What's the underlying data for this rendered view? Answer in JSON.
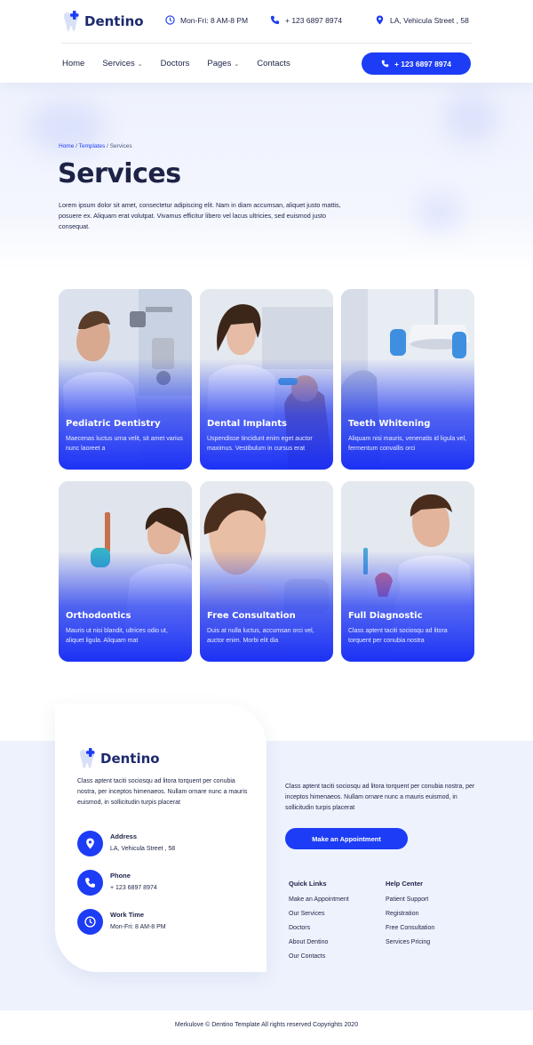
{
  "brand": {
    "name": "Dentino",
    "accent": "#1d3cf5"
  },
  "header": {
    "hours": "Mon-Fri: 8 AM-8 PM",
    "phone": "+ 123 6897 8974",
    "address": "LA, Vehicula Street , 58",
    "nav": [
      {
        "label": "Home",
        "dropdown": false
      },
      {
        "label": "Services",
        "dropdown": true
      },
      {
        "label": "Doctors",
        "dropdown": false
      },
      {
        "label": "Pages",
        "dropdown": true
      },
      {
        "label": "Contacts",
        "dropdown": false
      }
    ],
    "call_button": "+ 123 6897 8974"
  },
  "hero": {
    "breadcrumb": {
      "home": "Home",
      "sep1": " / ",
      "templates": "Templates",
      "sep2": " / ",
      "current": "Services"
    },
    "title": "Services",
    "description": "Lorem ipsum dolor sit amet, consectetur adipiscing elit. Nam in diam accumsan, aliquet justo mattis, posuere ex. Aliquam erat volutpat. Vivamus efficitur libero vel lacus ultricies, sed euismod justo consequat."
  },
  "services": [
    {
      "title": "Pediatric Dentistry",
      "desc": "Maecenas luctus urna velit, sit amet varius nunc laoreet a"
    },
    {
      "title": "Dental Implants",
      "desc": "Uspendisse tincidunt enim eget auctor maximus. Vestibulum in cursus erat"
    },
    {
      "title": "Teeth Whitening",
      "desc": "Aliquam nisi mauris, venenatis id ligula vel, fermentum convallis orci"
    },
    {
      "title": "Orthodontics",
      "desc": "Mauris ut nisi blandit, ultrices odio ut, aliquet ligula. Aliquam mat"
    },
    {
      "title": "Free Consultation",
      "desc": "Duis at nulla luctus, accumsan orci vel, auctor enim. Morbi elit dia"
    },
    {
      "title": "Full Diagnostic",
      "desc": "Class aptent taciti sociosqu ad litora torquent per conubia nostra"
    }
  ],
  "footer": {
    "brand": "Dentino",
    "about": "Class aptent taciti sociosqu ad litora torquent per conubia nostra, per inceptos himenaeos. Nullam ornare nunc a mauris euismod, in sollicitudin turpis placerat",
    "contacts": [
      {
        "label": "Address",
        "value": "LA, Vehicula Street , 58",
        "icon": "location-pin-icon"
      },
      {
        "label": "Phone",
        "value": "+ 123 6897 8974",
        "icon": "phone-icon"
      },
      {
        "label": "Work Time",
        "value": "Mon-Fri: 8 AM-8 PM",
        "icon": "clock-icon"
      }
    ],
    "side_text": "Class aptent taciti sociosqu ad litora torquent per conubia nostra, per inceptos himenaeos. Nullam ornare nunc a mauris euismod, in sollicitudin turpis placerat",
    "appointment_button": "Make an Appointment",
    "quick_links": {
      "title": "Quick Links",
      "items": [
        "Make an Appointment",
        "Our Services",
        "Doctors",
        "About Dentino",
        "Our Contacts"
      ]
    },
    "help_center": {
      "title": "Help Center",
      "items": [
        "Patient Support",
        "Registration",
        "Free Consultation",
        "Services Pricing"
      ]
    },
    "copyright": "Merkulove © Dentino Template All rights reserved Copyrights 2020"
  }
}
